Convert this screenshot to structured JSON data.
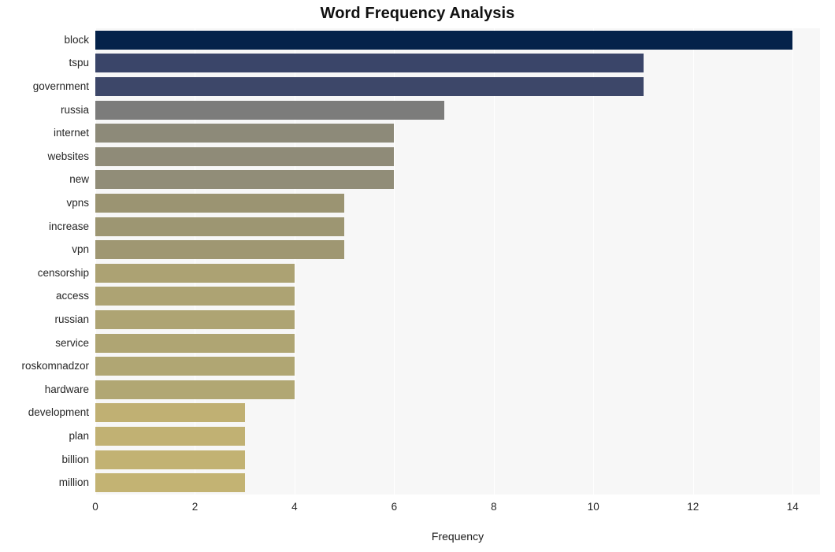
{
  "chart_data": {
    "type": "bar",
    "orientation": "horizontal",
    "title": "Word Frequency Analysis",
    "xlabel": "Frequency",
    "ylabel": "",
    "xlim": [
      0,
      14.55
    ],
    "grid": true,
    "legend": null,
    "xticks": [
      0,
      2,
      4,
      6,
      8,
      10,
      12,
      14
    ],
    "xtick_labels": [
      "0",
      "2",
      "4",
      "6",
      "8",
      "10",
      "12",
      "14"
    ],
    "categories": [
      "block",
      "tspu",
      "government",
      "russia",
      "internet",
      "websites",
      "new",
      "vpns",
      "increase",
      "vpn",
      "censorship",
      "access",
      "russian",
      "service",
      "roskomnadzor",
      "hardware",
      "development",
      "plan",
      "billion",
      "million"
    ],
    "values": [
      14,
      11,
      11,
      7,
      6,
      6,
      6,
      5,
      5,
      5,
      4,
      4,
      4,
      4,
      4,
      4,
      3,
      3,
      3,
      3
    ],
    "bar_colors": [
      "#04224a",
      "#3a4569",
      "#3d4769",
      "#7c7c7b",
      "#8d8a79",
      "#8f8b78",
      "#918d78",
      "#9b9472",
      "#9d9672",
      "#9f9772",
      "#aca273",
      "#ada373",
      "#aea473",
      "#afa573",
      "#b0a673",
      "#b1a773",
      "#c0b073",
      "#c1b173",
      "#c2b273",
      "#c3b373"
    ],
    "plot_background": "#f7f7f7",
    "figure_background": "#ffffff",
    "gridline_color": "#ffffff"
  }
}
